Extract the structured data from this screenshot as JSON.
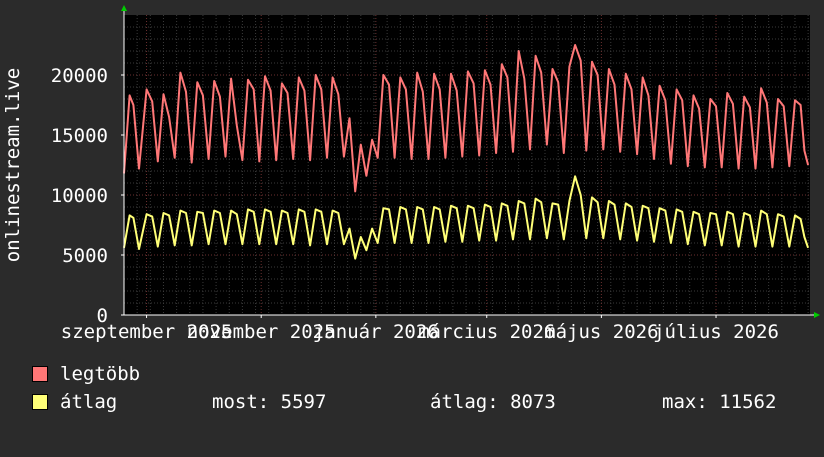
{
  "chart_data": {
    "type": "line",
    "ylabel": "onlinestream.live",
    "ylim": [
      0,
      25000
    ],
    "yticks": [
      0,
      5000,
      10000,
      15000,
      20000
    ],
    "xlim": [
      "2025-08-20",
      "2026-08-20"
    ],
    "xticks": [
      {
        "date": "2025-09-01",
        "label": "szeptember 2025"
      },
      {
        "date": "2025-11-01",
        "label": "november 2025"
      },
      {
        "date": "2026-01-01",
        "label": "január 2026"
      },
      {
        "date": "2026-03-01",
        "label": "március 2026"
      },
      {
        "date": "2026-05-01",
        "label": "május 2026"
      },
      {
        "date": "2026-07-01",
        "label": "július 2026"
      }
    ],
    "grid": true,
    "legend_position": "bottom",
    "series": [
      {
        "name": "legtöbb",
        "color": "#ff7777",
        "points": [
          [
            "2025-08-20",
            11800
          ],
          [
            "2025-08-23",
            18300
          ],
          [
            "2025-08-25",
            17500
          ],
          [
            "2025-08-28",
            12200
          ],
          [
            "2025-09-01",
            18800
          ],
          [
            "2025-09-04",
            17800
          ],
          [
            "2025-09-07",
            12800
          ],
          [
            "2025-09-10",
            18400
          ],
          [
            "2025-09-13",
            16500
          ],
          [
            "2025-09-16",
            13100
          ],
          [
            "2025-09-19",
            20200
          ],
          [
            "2025-09-22",
            18600
          ],
          [
            "2025-09-25",
            12700
          ],
          [
            "2025-09-28",
            19400
          ],
          [
            "2025-10-01",
            18300
          ],
          [
            "2025-10-04",
            13000
          ],
          [
            "2025-10-07",
            19500
          ],
          [
            "2025-10-10",
            18200
          ],
          [
            "2025-10-13",
            13200
          ],
          [
            "2025-10-16",
            19700
          ],
          [
            "2025-10-19",
            15800
          ],
          [
            "2025-10-22",
            12900
          ],
          [
            "2025-10-25",
            19600
          ],
          [
            "2025-10-28",
            18800
          ],
          [
            "2025-10-31",
            12800
          ],
          [
            "2025-11-03",
            19900
          ],
          [
            "2025-11-06",
            18700
          ],
          [
            "2025-11-09",
            12900
          ],
          [
            "2025-11-12",
            19300
          ],
          [
            "2025-11-15",
            18500
          ],
          [
            "2025-11-18",
            13000
          ],
          [
            "2025-11-21",
            19800
          ],
          [
            "2025-11-24",
            18700
          ],
          [
            "2025-11-27",
            12900
          ],
          [
            "2025-11-30",
            20000
          ],
          [
            "2025-12-03",
            18800
          ],
          [
            "2025-12-06",
            13100
          ],
          [
            "2025-12-09",
            19800
          ],
          [
            "2025-12-12",
            18400
          ],
          [
            "2025-12-15",
            13200
          ],
          [
            "2025-12-18",
            16400
          ],
          [
            "2025-12-21",
            10300
          ],
          [
            "2025-12-24",
            14200
          ],
          [
            "2025-12-27",
            11600
          ],
          [
            "2025-12-30",
            14600
          ],
          [
            "2026-01-02",
            13100
          ],
          [
            "2026-01-05",
            20000
          ],
          [
            "2026-01-08",
            19200
          ],
          [
            "2026-01-11",
            13100
          ],
          [
            "2026-01-14",
            19800
          ],
          [
            "2026-01-17",
            18800
          ],
          [
            "2026-01-20",
            13000
          ],
          [
            "2026-01-23",
            20200
          ],
          [
            "2026-01-26",
            18600
          ],
          [
            "2026-01-29",
            13000
          ],
          [
            "2026-02-01",
            20100
          ],
          [
            "2026-02-04",
            18800
          ],
          [
            "2026-02-07",
            13100
          ],
          [
            "2026-02-10",
            20100
          ],
          [
            "2026-02-13",
            18700
          ],
          [
            "2026-02-16",
            13200
          ],
          [
            "2026-02-19",
            20300
          ],
          [
            "2026-02-22",
            19300
          ],
          [
            "2026-02-25",
            13300
          ],
          [
            "2026-02-28",
            20400
          ],
          [
            "2026-03-03",
            19200
          ],
          [
            "2026-03-06",
            13500
          ],
          [
            "2026-03-09",
            20900
          ],
          [
            "2026-03-12",
            19800
          ],
          [
            "2026-03-15",
            13600
          ],
          [
            "2026-03-18",
            22000
          ],
          [
            "2026-03-21",
            19700
          ],
          [
            "2026-03-24",
            13800
          ],
          [
            "2026-03-27",
            21600
          ],
          [
            "2026-03-30",
            20200
          ],
          [
            "2026-04-02",
            14200
          ],
          [
            "2026-04-05",
            20500
          ],
          [
            "2026-04-08",
            19400
          ],
          [
            "2026-04-11",
            13500
          ],
          [
            "2026-04-14",
            20700
          ],
          [
            "2026-04-17",
            22500
          ],
          [
            "2026-04-20",
            21200
          ],
          [
            "2026-04-23",
            13700
          ],
          [
            "2026-04-26",
            21100
          ],
          [
            "2026-04-29",
            20000
          ],
          [
            "2026-05-02",
            13800
          ],
          [
            "2026-05-05",
            20500
          ],
          [
            "2026-05-08",
            19200
          ],
          [
            "2026-05-11",
            13600
          ],
          [
            "2026-05-14",
            20100
          ],
          [
            "2026-05-17",
            18800
          ],
          [
            "2026-05-20",
            13400
          ],
          [
            "2026-05-23",
            19800
          ],
          [
            "2026-05-26",
            18300
          ],
          [
            "2026-05-29",
            13000
          ],
          [
            "2026-06-01",
            19100
          ],
          [
            "2026-06-04",
            17900
          ],
          [
            "2026-06-07",
            12600
          ],
          [
            "2026-06-10",
            18800
          ],
          [
            "2026-06-13",
            17900
          ],
          [
            "2026-06-16",
            12400
          ],
          [
            "2026-06-19",
            18300
          ],
          [
            "2026-06-22",
            17200
          ],
          [
            "2026-06-25",
            12300
          ],
          [
            "2026-06-28",
            18000
          ],
          [
            "2026-07-01",
            17400
          ],
          [
            "2026-07-04",
            12300
          ],
          [
            "2026-07-07",
            18500
          ],
          [
            "2026-07-10",
            17600
          ],
          [
            "2026-07-13",
            12200
          ],
          [
            "2026-07-16",
            18200
          ],
          [
            "2026-07-19",
            17300
          ],
          [
            "2026-07-22",
            12200
          ],
          [
            "2026-07-25",
            18900
          ],
          [
            "2026-07-28",
            17700
          ],
          [
            "2026-07-31",
            12300
          ],
          [
            "2026-08-03",
            18000
          ],
          [
            "2026-08-06",
            17400
          ],
          [
            "2026-08-09",
            12400
          ],
          [
            "2026-08-12",
            17900
          ],
          [
            "2026-08-15",
            17500
          ],
          [
            "2026-08-17",
            13700
          ],
          [
            "2026-08-19",
            12500
          ]
        ]
      },
      {
        "name": "átlag",
        "color": "#ffff77",
        "points": [
          [
            "2025-08-20",
            5600
          ],
          [
            "2025-08-23",
            8300
          ],
          [
            "2025-08-25",
            8100
          ],
          [
            "2025-08-28",
            5500
          ],
          [
            "2025-09-01",
            8400
          ],
          [
            "2025-09-04",
            8200
          ],
          [
            "2025-09-07",
            5700
          ],
          [
            "2025-09-10",
            8500
          ],
          [
            "2025-09-13",
            8300
          ],
          [
            "2025-09-16",
            5800
          ],
          [
            "2025-09-19",
            8700
          ],
          [
            "2025-09-22",
            8500
          ],
          [
            "2025-09-25",
            5800
          ],
          [
            "2025-09-28",
            8600
          ],
          [
            "2025-10-01",
            8500
          ],
          [
            "2025-10-04",
            5900
          ],
          [
            "2025-10-07",
            8700
          ],
          [
            "2025-10-10",
            8500
          ],
          [
            "2025-10-13",
            5900
          ],
          [
            "2025-10-16",
            8700
          ],
          [
            "2025-10-19",
            8400
          ],
          [
            "2025-10-22",
            5900
          ],
          [
            "2025-10-25",
            8800
          ],
          [
            "2025-10-28",
            8600
          ],
          [
            "2025-10-31",
            5900
          ],
          [
            "2025-11-03",
            8800
          ],
          [
            "2025-11-06",
            8600
          ],
          [
            "2025-11-09",
            5900
          ],
          [
            "2025-11-12",
            8700
          ],
          [
            "2025-11-15",
            8500
          ],
          [
            "2025-11-18",
            5900
          ],
          [
            "2025-11-21",
            8800
          ],
          [
            "2025-11-24",
            8600
          ],
          [
            "2025-11-27",
            5800
          ],
          [
            "2025-11-30",
            8800
          ],
          [
            "2025-12-03",
            8600
          ],
          [
            "2025-12-06",
            5900
          ],
          [
            "2025-12-09",
            8700
          ],
          [
            "2025-12-12",
            8500
          ],
          [
            "2025-12-15",
            5900
          ],
          [
            "2025-12-18",
            7200
          ],
          [
            "2025-12-21",
            4700
          ],
          [
            "2025-12-24",
            6500
          ],
          [
            "2025-12-27",
            5400
          ],
          [
            "2025-12-30",
            7200
          ],
          [
            "2026-01-02",
            6000
          ],
          [
            "2026-01-05",
            8900
          ],
          [
            "2026-01-08",
            8800
          ],
          [
            "2026-01-11",
            6000
          ],
          [
            "2026-01-14",
            9000
          ],
          [
            "2026-01-17",
            8800
          ],
          [
            "2026-01-20",
            6000
          ],
          [
            "2026-01-23",
            9000
          ],
          [
            "2026-01-26",
            8800
          ],
          [
            "2026-01-29",
            6000
          ],
          [
            "2026-02-01",
            9000
          ],
          [
            "2026-02-04",
            8800
          ],
          [
            "2026-02-07",
            6100
          ],
          [
            "2026-02-10",
            9100
          ],
          [
            "2026-02-13",
            8900
          ],
          [
            "2026-02-16",
            6100
          ],
          [
            "2026-02-19",
            9100
          ],
          [
            "2026-02-22",
            8900
          ],
          [
            "2026-02-25",
            6200
          ],
          [
            "2026-02-28",
            9200
          ],
          [
            "2026-03-03",
            9000
          ],
          [
            "2026-03-06",
            6200
          ],
          [
            "2026-03-09",
            9300
          ],
          [
            "2026-03-12",
            9100
          ],
          [
            "2026-03-15",
            6300
          ],
          [
            "2026-03-18",
            9500
          ],
          [
            "2026-03-21",
            9300
          ],
          [
            "2026-03-24",
            6300
          ],
          [
            "2026-03-27",
            9700
          ],
          [
            "2026-03-30",
            9400
          ],
          [
            "2026-04-02",
            6400
          ],
          [
            "2026-04-05",
            9300
          ],
          [
            "2026-04-08",
            9200
          ],
          [
            "2026-04-11",
            6300
          ],
          [
            "2026-04-14",
            9500
          ],
          [
            "2026-04-17",
            11562
          ],
          [
            "2026-04-20",
            10000
          ],
          [
            "2026-04-23",
            6400
          ],
          [
            "2026-04-26",
            9800
          ],
          [
            "2026-04-29",
            9400
          ],
          [
            "2026-05-02",
            6400
          ],
          [
            "2026-05-05",
            9500
          ],
          [
            "2026-05-08",
            9200
          ],
          [
            "2026-05-11",
            6300
          ],
          [
            "2026-05-14",
            9300
          ],
          [
            "2026-05-17",
            9000
          ],
          [
            "2026-05-20",
            6200
          ],
          [
            "2026-05-23",
            9100
          ],
          [
            "2026-05-26",
            8900
          ],
          [
            "2026-05-29",
            6100
          ],
          [
            "2026-06-01",
            8900
          ],
          [
            "2026-06-04",
            8700
          ],
          [
            "2026-06-07",
            6000
          ],
          [
            "2026-06-10",
            8800
          ],
          [
            "2026-06-13",
            8600
          ],
          [
            "2026-06-16",
            5900
          ],
          [
            "2026-06-19",
            8600
          ],
          [
            "2026-06-22",
            8400
          ],
          [
            "2026-06-25",
            5800
          ],
          [
            "2026-06-28",
            8500
          ],
          [
            "2026-07-01",
            8400
          ],
          [
            "2026-07-04",
            5800
          ],
          [
            "2026-07-07",
            8600
          ],
          [
            "2026-07-10",
            8400
          ],
          [
            "2026-07-13",
            5700
          ],
          [
            "2026-07-16",
            8500
          ],
          [
            "2026-07-19",
            8300
          ],
          [
            "2026-07-22",
            5700
          ],
          [
            "2026-07-25",
            8700
          ],
          [
            "2026-07-28",
            8400
          ],
          [
            "2026-07-31",
            5700
          ],
          [
            "2026-08-03",
            8400
          ],
          [
            "2026-08-06",
            8200
          ],
          [
            "2026-08-09",
            5700
          ],
          [
            "2026-08-12",
            8300
          ],
          [
            "2026-08-15",
            8000
          ],
          [
            "2026-08-17",
            6500
          ],
          [
            "2026-08-19",
            5597
          ]
        ]
      }
    ]
  },
  "legend": {
    "items": [
      {
        "label": "legtöbb",
        "color": "#ff7777"
      },
      {
        "label": "átlag",
        "color": "#ffff77"
      }
    ]
  },
  "stats": {
    "current": "most: 5597",
    "average": "átlag: 8073",
    "max": "max: 11562"
  }
}
